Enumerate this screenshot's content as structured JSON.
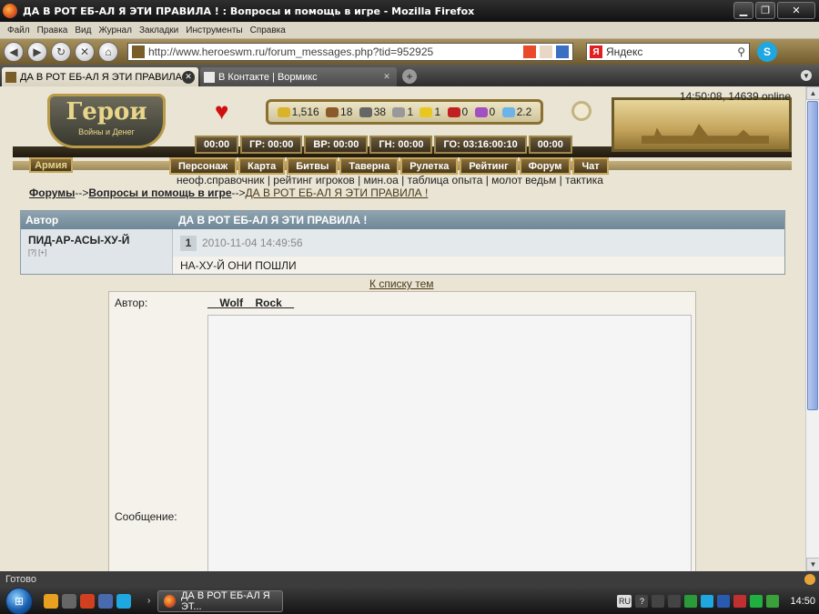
{
  "window": {
    "title": "ДА В РОТ ЕБ-АЛ Я ЭТИ ПРАВИЛА ! : Вопросы и помощь в игре - Mozilla Firefox"
  },
  "menu": [
    "Файл",
    "Правка",
    "Вид",
    "Журнал",
    "Закладки",
    "Инструменты",
    "Справка"
  ],
  "nav": {
    "url": "http://www.heroeswm.ru/forum_messages.php?tid=952925",
    "search_engine": "Яндекс"
  },
  "tabs": [
    {
      "label": "ДА В РОТ ЕБ-АЛ Я ЭТИ ПРАВИЛА ! : Во...",
      "active": true
    },
    {
      "label": "В Контакте | Вормикс",
      "active": false
    }
  ],
  "game": {
    "clock": "14:50:08, 14639 online",
    "logo_title": "Герои",
    "logo_subtitle": "Войны и Денег",
    "resources": [
      "1,516",
      "18",
      "38",
      "1",
      "1",
      "0",
      "0",
      "2.2"
    ],
    "timers": [
      "00:00",
      "ГР: 00:00",
      "ВР: 00:00",
      "ГН: 00:00",
      "ГО: 03:16:00:10",
      "00:00"
    ],
    "army": "Армия",
    "menu": [
      "Персонаж",
      "Карта",
      "Битвы",
      "Таверна",
      "Рулетка",
      "Рейтинг",
      "Форум",
      "Чат"
    ],
    "sublinks": "неоф.справочник | рейтинг игроков | мин.оа | таблица опыта | молот ведьм | тактика"
  },
  "breadcrumb": {
    "forums": "Форумы",
    "sep": "-->",
    "section": "Вопросы и помощь в игре",
    "topic": "ДА В РОТ ЕБ-АЛ Я ЭТИ ПРАВИЛА !"
  },
  "topic": {
    "col_author": "Автор",
    "title": "ДА В РОТ ЕБ-АЛ Я ЭТИ ПРАВИЛА !",
    "post": {
      "author": "ПИД-АР-АСЫ-ХУ-Й",
      "author_links": "[?] [+]",
      "number": "1",
      "date": "2010-11-04 14:49:56",
      "text": "НА-ХУ-Й ОНИ ПОШЛИ"
    },
    "back_link": "К списку тем"
  },
  "reply": {
    "author_label": "Автор:",
    "author_value": "__Wolf__Rock__",
    "message_label": "Сообщение:"
  },
  "status": {
    "text": "Готово"
  },
  "taskbar": {
    "task": "ДА В РОТ ЕБ-АЛ Я ЭТ...",
    "lang": "RU",
    "clock": "14:50"
  }
}
